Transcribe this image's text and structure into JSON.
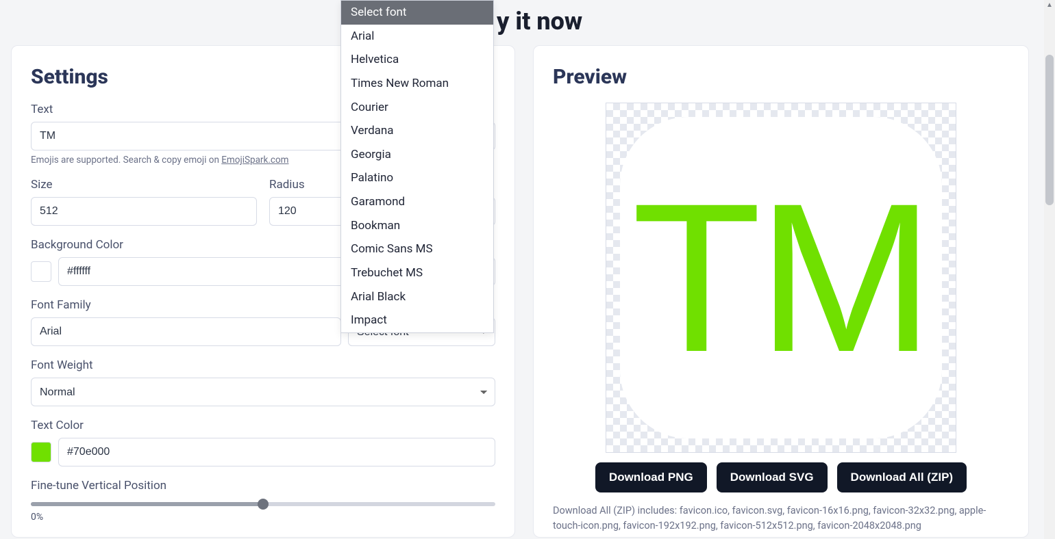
{
  "page": {
    "title_fragment": "y it now"
  },
  "settings": {
    "heading": "Settings",
    "text_label": "Text",
    "text_value": "TM",
    "emoji_hint_prefix": "Emojis are supported. Search & copy emoji on ",
    "emoji_link_text": "EmojiSpark.com",
    "size_label": "Size",
    "size_value": "512",
    "radius_label": "Radius",
    "radius_value": "120",
    "bg_label": "Background Color",
    "bg_value": "#ffffff",
    "font_label": "Font Family",
    "font_value": "Arial",
    "font_select_label": "Select font",
    "weight_label": "Font Weight",
    "weight_value": "Normal",
    "text_color_label": "Text Color",
    "text_color_value": "#70e000",
    "finetune_label": "Fine-tune Vertical Position",
    "finetune_value": "0%"
  },
  "dropdown": {
    "options": [
      "Select font",
      "Arial",
      "Helvetica",
      "Times New Roman",
      "Courier",
      "Verdana",
      "Georgia",
      "Palatino",
      "Garamond",
      "Bookman",
      "Comic Sans MS",
      "Trebuchet MS",
      "Arial Black",
      "Impact"
    ]
  },
  "preview": {
    "heading": "Preview",
    "sample_text": "TM",
    "btn_png": "Download PNG",
    "btn_svg": "Download SVG",
    "btn_zip": "Download All (ZIP)",
    "caption": "Download All (ZIP) includes: favicon.ico, favicon.svg, favicon-16x16.png, favicon-32x32.png, apple-touch-icon.png, favicon-192x192.png, favicon-512x512.png, favicon-2048x2048.png"
  },
  "colors": {
    "brand_green": "#70e000",
    "heading": "#2b3658"
  }
}
